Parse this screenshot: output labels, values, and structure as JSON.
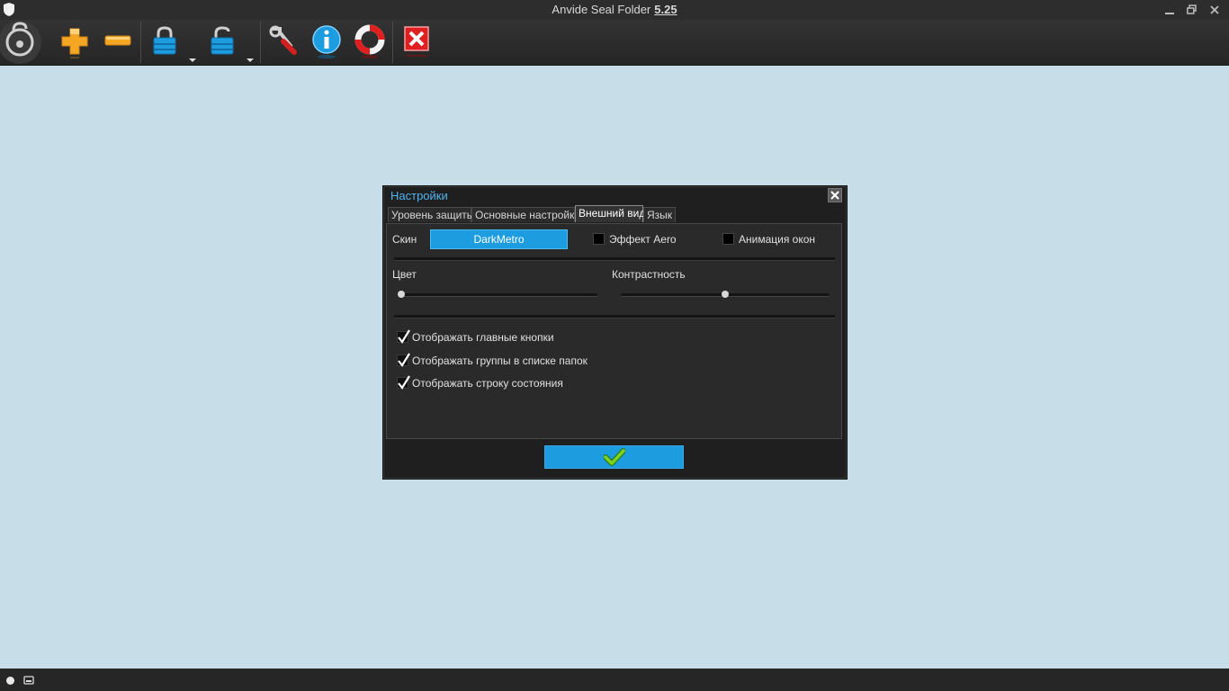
{
  "window": {
    "title": "Anvide Seal Folder",
    "version": "5.25",
    "icons": [
      "app-shield-icon",
      "minimize-icon",
      "restore-icon",
      "close-icon"
    ]
  },
  "toolbar": {
    "buttons": [
      {
        "name": "logo-lock-icon"
      },
      {
        "name": "add-folder-icon",
        "color": "#f5a623"
      },
      {
        "name": "remove-folder-icon",
        "color": "#f5a623"
      },
      {
        "name": "close-access-icon",
        "color": "#1e9ce0"
      },
      {
        "name": "open-access-icon",
        "color": "#1e9ce0"
      },
      {
        "name": "settings-wrench-icon",
        "color": "#d02020"
      },
      {
        "name": "info-icon",
        "color": "#1e9ce0"
      },
      {
        "name": "help-lifebuoy-icon",
        "color": "#e02020"
      },
      {
        "name": "exit-icon",
        "color": "#e02020"
      }
    ]
  },
  "dialog": {
    "title": "Настройки",
    "tabs": [
      {
        "label": "Уровень защиты"
      },
      {
        "label": "Основные настройки"
      },
      {
        "label": "Внешний вид",
        "active": true
      },
      {
        "label": "Язык"
      }
    ],
    "skin_label": "Скин",
    "skin_value": "DarkMetro",
    "aero_label": "Эффект Aero",
    "aero_checked": false,
    "anim_label": "Анимация окон",
    "anim_checked": false,
    "color_label": "Цвет",
    "color_value": 0,
    "contrast_label": "Контрастность",
    "contrast_value": 0.5,
    "checkboxes": [
      {
        "label": "Отображать главные кнопки",
        "checked": true
      },
      {
        "label": "Отображать группы в списке папок",
        "checked": true
      },
      {
        "label": "Отображать строку состояния",
        "checked": true
      }
    ],
    "ok_icon": "checkmark-icon"
  },
  "colors": {
    "accent": "#1e9ce0",
    "workspace": "#c7dde7",
    "title_text": "#4fb3f0"
  }
}
